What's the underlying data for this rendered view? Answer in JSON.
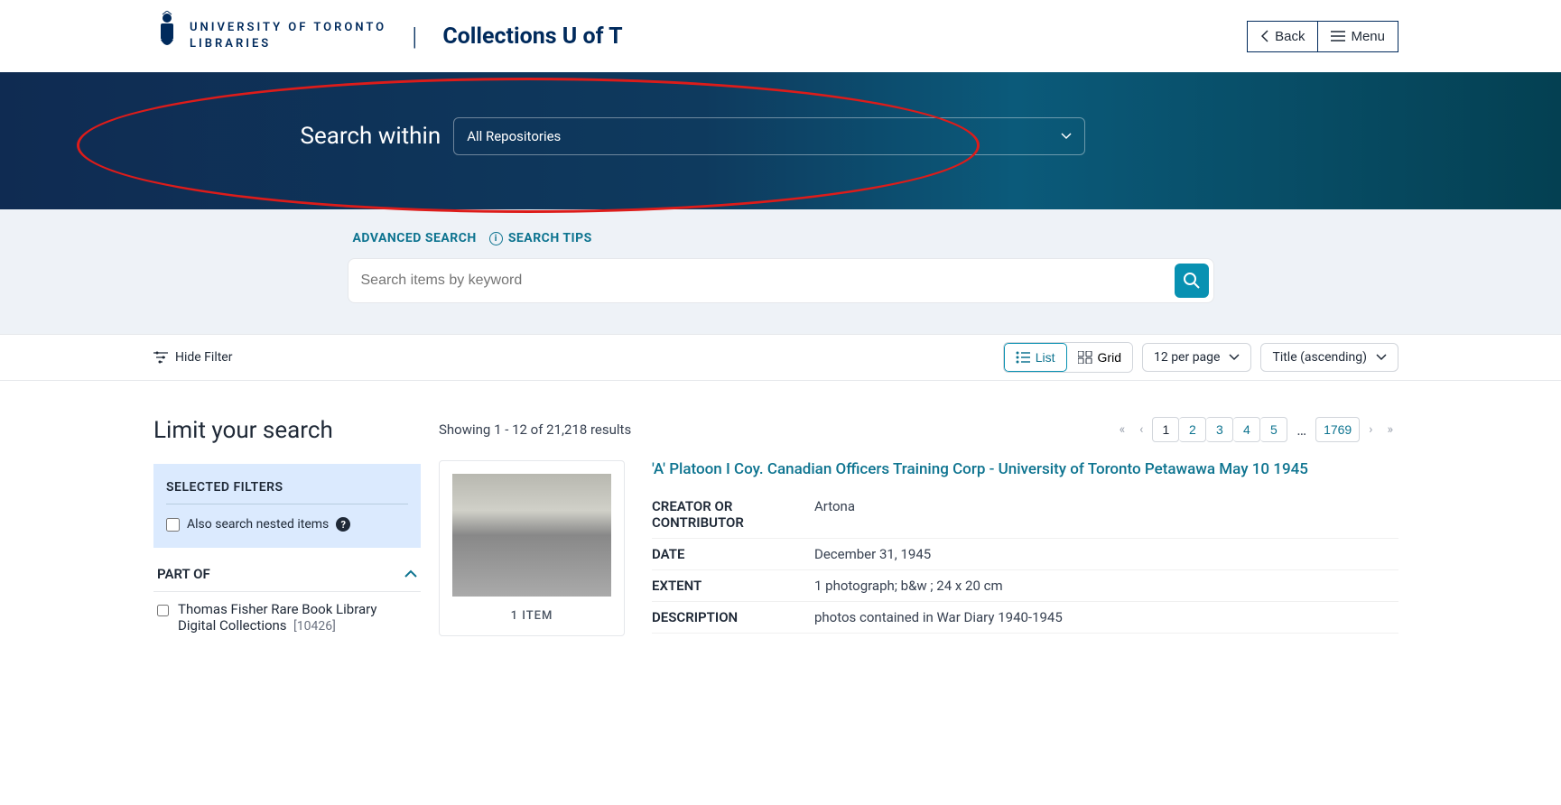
{
  "header": {
    "logo_line1": "UNIVERSITY OF TORONTO",
    "logo_line2": "LIBRARIES",
    "brand": "Collections U of T",
    "back": "Back",
    "menu": "Menu"
  },
  "banner": {
    "label": "Search within",
    "repository": "All Repositories"
  },
  "tools": {
    "advanced": "ADVANCED SEARCH",
    "tips": "SEARCH TIPS",
    "placeholder": "Search items by keyword"
  },
  "controls": {
    "hide_filter": "Hide Filter",
    "view_list": "List",
    "view_grid": "Grid",
    "per_page": "12 per page",
    "sort": "Title (ascending)"
  },
  "sidebar": {
    "limit_title": "Limit your search",
    "selected_filters": "SELECTED FILTERS",
    "nested_label": "Also search nested items",
    "facet_partof": "PART OF",
    "facet_item_label": "Thomas Fisher Rare Book Library Digital Collections",
    "facet_item_count": "[10426]"
  },
  "results": {
    "count_text": "Showing 1 - 12 of 21,218 results",
    "pages": [
      "1",
      "2",
      "3",
      "4",
      "5"
    ],
    "last_page": "1769",
    "thumb_label": "1 ITEM",
    "item": {
      "title": "'A' Platoon I Coy. Canadian Officers Training Corp - University of Toronto Petawawa May 10 1945",
      "meta": [
        {
          "label": "CREATOR OR CONTRIBUTOR",
          "value": "Artona"
        },
        {
          "label": "DATE",
          "value": "December 31, 1945"
        },
        {
          "label": "EXTENT",
          "value": "1 photograph; b&w ; 24 x 20 cm"
        },
        {
          "label": "DESCRIPTION",
          "value": "photos contained in War Diary 1940-1945"
        }
      ]
    }
  }
}
